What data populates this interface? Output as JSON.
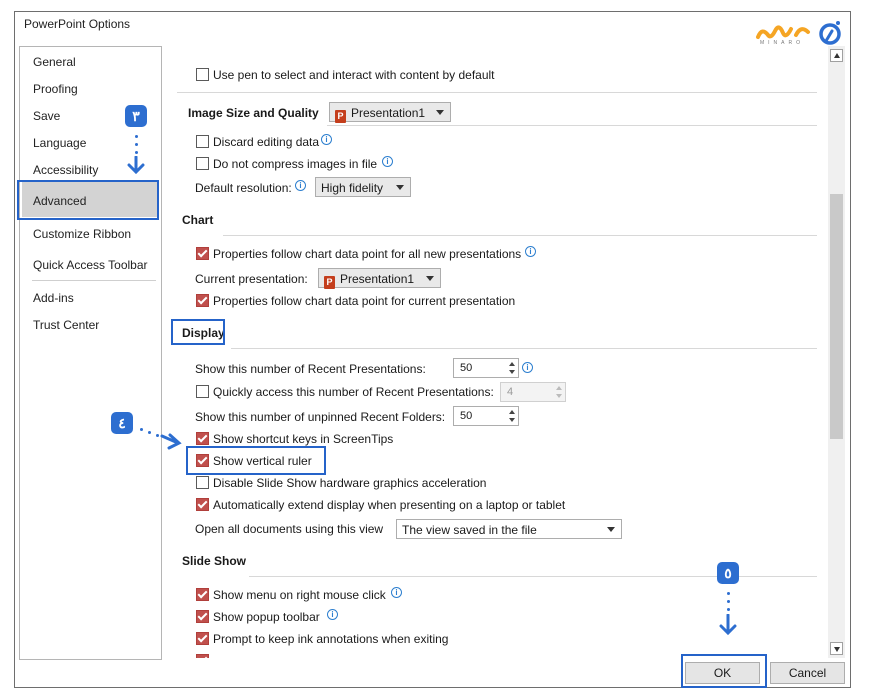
{
  "window": {
    "title": "PowerPoint Options"
  },
  "logo": {
    "text": "MINARO"
  },
  "sidebar": {
    "items": [
      {
        "label": "General"
      },
      {
        "label": "Proofing"
      },
      {
        "label": "Save"
      },
      {
        "label": "Language"
      },
      {
        "label": "Accessibility"
      },
      {
        "label": "Advanced"
      },
      {
        "label": "Customize Ribbon"
      },
      {
        "label": "Quick Access Toolbar"
      },
      {
        "label": "Add-ins"
      },
      {
        "label": "Trust Center"
      }
    ],
    "selected": "Advanced"
  },
  "pen": {
    "use_pen": {
      "label": "Use pen to select and interact with content by default",
      "checked": false
    }
  },
  "image": {
    "heading": "Image Size and Quality",
    "doc_dropdown": "Presentation1",
    "discard": {
      "label": "Discard editing data",
      "checked": false
    },
    "no_compress": {
      "label": "Do not compress images in file",
      "checked": false
    },
    "resolution_label": "Default resolution:",
    "resolution_value": "High fidelity"
  },
  "chart": {
    "heading": "Chart",
    "prop_all": {
      "label": "Properties follow chart data point for all new presentations",
      "checked": true
    },
    "current_label": "Current presentation:",
    "current_dropdown": "Presentation1",
    "prop_current": {
      "label": "Properties follow chart data point for current presentation",
      "checked": true
    }
  },
  "display": {
    "heading": "Display",
    "recent_label": "Show this number of Recent Presentations:",
    "recent_value": "50",
    "quick_access": {
      "label": "Quickly access this number of Recent Presentations:",
      "checked": false
    },
    "quick_value": "4",
    "folders_label": "Show this number of unpinned Recent Folders:",
    "folders_value": "50",
    "shortcut_keys": {
      "label": "Show shortcut keys in ScreenTips",
      "checked": true
    },
    "vertical_ruler": {
      "label": "Show vertical ruler",
      "checked": true
    },
    "disable_hw": {
      "label": "Disable Slide Show hardware graphics acceleration",
      "checked": false
    },
    "extend_display": {
      "label": "Automatically extend display when presenting on a laptop or tablet",
      "checked": true
    },
    "open_label": "Open all documents using this view",
    "open_value": "The view saved in the file"
  },
  "slideshow": {
    "heading": "Slide Show",
    "menu_right": {
      "label": "Show menu on right mouse click",
      "checked": true
    },
    "popup": {
      "label": "Show popup toolbar",
      "checked": true
    },
    "ink": {
      "label": "Prompt to keep ink annotations when exiting",
      "checked": true
    }
  },
  "buttons": {
    "ok": "OK",
    "cancel": "Cancel"
  },
  "annotations": {
    "step3": "٣",
    "step4": "٤",
    "step5": "٥"
  },
  "colors": {
    "highlight": "#2563c9",
    "badge": "#2d6ed0",
    "checked": "#c0504d"
  }
}
